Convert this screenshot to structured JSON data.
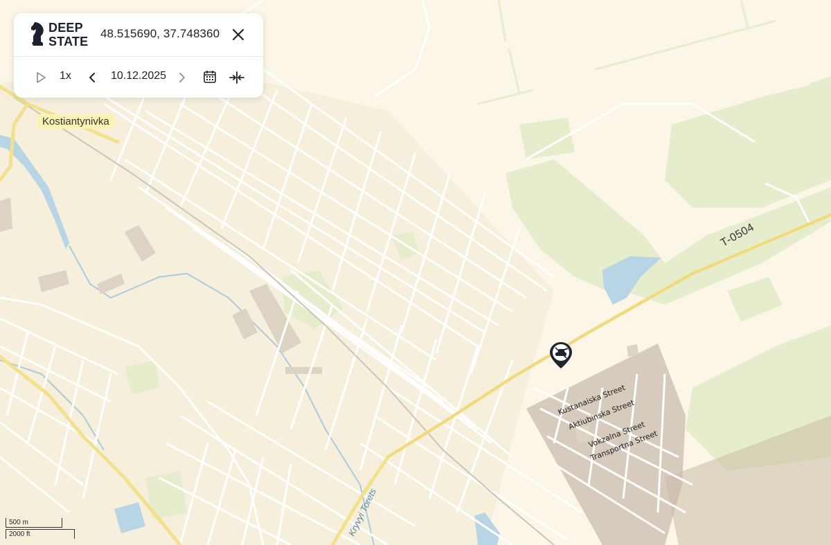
{
  "app": {
    "logo_line1": "DEEP",
    "logo_line2": "STATE"
  },
  "header": {
    "coordinates": "48.515690, 37.748360"
  },
  "timeline": {
    "speed": "1x",
    "date": "10.12.2025"
  },
  "map": {
    "town_label": "Kostiantynivka",
    "road_label": "T-0504",
    "river_label": "Kryvyi Torets",
    "streets": [
      "Kustanaiska Street",
      "Aktiubinska Street",
      "Vokzalna Street",
      "Transportna Street"
    ],
    "scale": {
      "metric": "500 m",
      "imperial": "2000 ft"
    },
    "colors": {
      "land": "#fbf6e8",
      "road": "#ffffff",
      "major_road": "#f3e08d",
      "park": "#e5edcc",
      "water": "#b7d5e4",
      "occupied_zone": "#b9a89a"
    }
  },
  "icons": {
    "close": "close-icon",
    "play": "play-icon",
    "prev": "chevron-left-icon",
    "next": "chevron-right-icon",
    "calendar": "calendar-icon",
    "collapse": "collapse-icon",
    "marker": "tank-marker-icon"
  }
}
